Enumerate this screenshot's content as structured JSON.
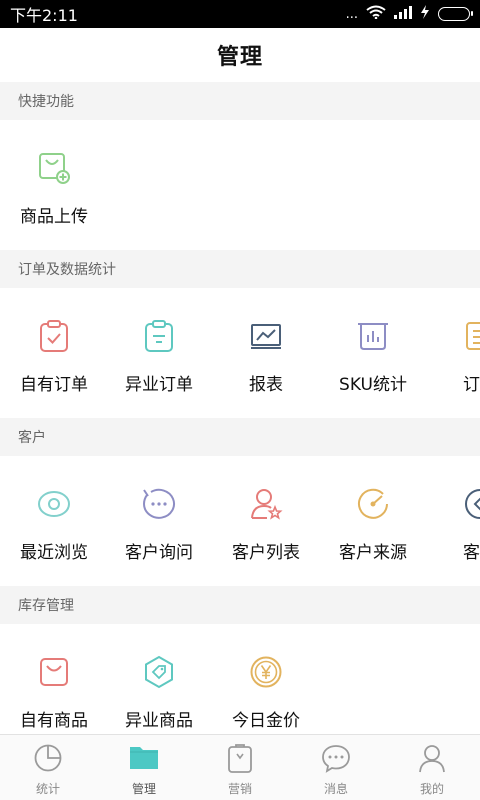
{
  "status_bar": {
    "time": "下午2:11",
    "dots": "..."
  },
  "page_title": "管理",
  "colors": {
    "accent": "#4cc8c4",
    "grey_icon": "#9a9a9a",
    "red": "#e57b78",
    "green": "#8fd18a",
    "teal": "#5ec8c0",
    "navy": "#4a5f78",
    "gold": "#e2b35e",
    "purple": "#8d8dc4",
    "light_teal": "#82d0cc"
  },
  "sections": [
    {
      "title": "快捷功能",
      "items": [
        {
          "label": "商品上传",
          "icon": "bag-plus-icon"
        }
      ]
    },
    {
      "title": "订单及数据统计",
      "items": [
        {
          "label": "自有订单",
          "icon": "clipboard-check-icon"
        },
        {
          "label": "异业订单",
          "icon": "clipboard-list-icon"
        },
        {
          "label": "报表",
          "icon": "line-chart-icon"
        },
        {
          "label": "SKU统计",
          "icon": "bar-chart-icon"
        },
        {
          "label": "订单",
          "icon": "order-list-icon"
        }
      ]
    },
    {
      "title": "客户",
      "items": [
        {
          "label": "最近浏览",
          "icon": "eye-icon"
        },
        {
          "label": "客户询问",
          "icon": "chat-bubble-icon"
        },
        {
          "label": "客户列表",
          "icon": "user-star-icon"
        },
        {
          "label": "客户来源",
          "icon": "gauge-icon"
        },
        {
          "label": "客户",
          "icon": "back-circle-icon"
        }
      ]
    },
    {
      "title": "库存管理",
      "items": [
        {
          "label": "自有商品",
          "icon": "bag-icon"
        },
        {
          "label": "异业商品",
          "icon": "tag-icon"
        },
        {
          "label": "今日金价",
          "icon": "yen-coin-icon"
        }
      ]
    }
  ],
  "tabs": [
    {
      "label": "统计",
      "icon": "pie-chart-icon"
    },
    {
      "label": "管理",
      "icon": "folder-icon",
      "active": true
    },
    {
      "label": "营销",
      "icon": "shopping-bag-icon"
    },
    {
      "label": "消息",
      "icon": "message-icon"
    },
    {
      "label": "我的",
      "icon": "person-icon"
    }
  ]
}
